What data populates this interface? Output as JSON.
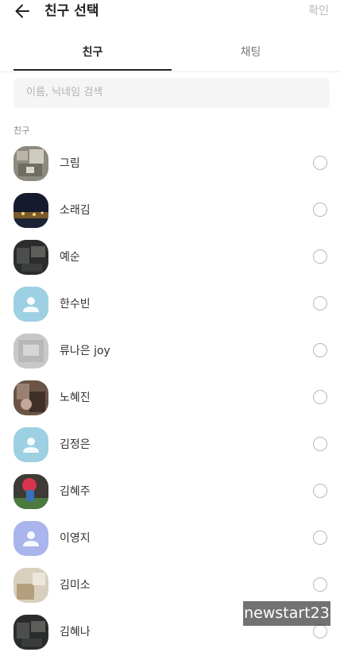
{
  "header": {
    "title": "친구 선택",
    "confirm_label": "확인"
  },
  "tabs": [
    {
      "label": "친구"
    },
    {
      "label": "채팅"
    }
  ],
  "search": {
    "placeholder": "이름, 닉네임 검색"
  },
  "section_label": "친구",
  "friends": [
    {
      "name": "그림",
      "avatar": "photo-stone"
    },
    {
      "name": "소래김",
      "avatar": "photo-night"
    },
    {
      "name": "예순",
      "avatar": "photo-dark"
    },
    {
      "name": "한수빈",
      "avatar": "default-blue"
    },
    {
      "name": "류나은 joy",
      "avatar": "photo-grey"
    },
    {
      "name": "노혜진",
      "avatar": "photo-brown"
    },
    {
      "name": "김정은",
      "avatar": "default-blue"
    },
    {
      "name": "김혜주",
      "avatar": "photo-flower"
    },
    {
      "name": "이영지",
      "avatar": "default-purple"
    },
    {
      "name": "김미소",
      "avatar": "photo-beige"
    },
    {
      "name": "김혜나",
      "avatar": "photo-dark"
    }
  ],
  "watermark": "newstart23",
  "colors": {
    "default_blue": "#9dd0e2",
    "default_purple": "#a9b5ec"
  }
}
